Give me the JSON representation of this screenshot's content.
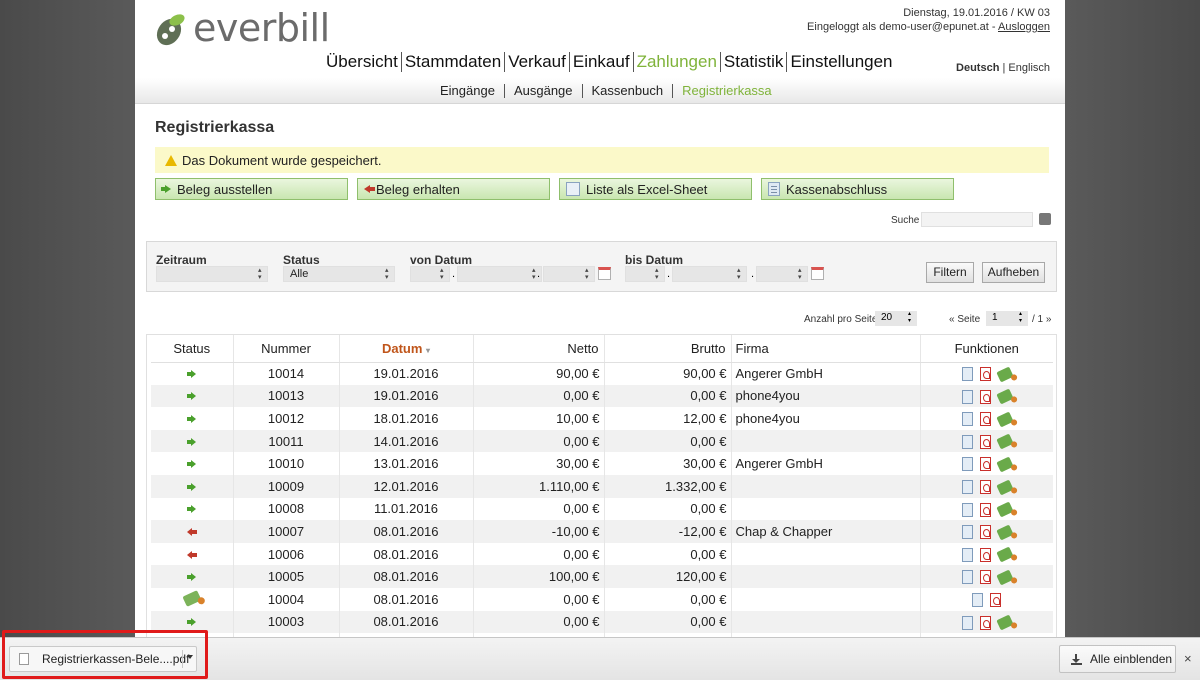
{
  "header": {
    "logo_text": "everbill",
    "date_line": "Dienstag, 19.01.2016 / KW 03",
    "login_line": "Eingeloggt als demo-user@epunet.at -",
    "logout_label": "Ausloggen"
  },
  "mainnav": [
    {
      "label": "Übersicht",
      "active": false
    },
    {
      "label": "Stammdaten",
      "active": false
    },
    {
      "label": "Verkauf",
      "active": false
    },
    {
      "label": "Einkauf",
      "active": false
    },
    {
      "label": "Zahlungen",
      "active": true
    },
    {
      "label": "Statistik",
      "active": false
    },
    {
      "label": "Einstellungen",
      "active": false
    }
  ],
  "language": {
    "current": "Deutsch",
    "separator": "|",
    "other": "Englisch"
  },
  "subnav": [
    {
      "label": "Eingänge",
      "active": false
    },
    {
      "label": "Ausgänge",
      "active": false
    },
    {
      "label": "Kassenbuch",
      "active": false
    },
    {
      "label": "Registrierkassa",
      "active": true
    }
  ],
  "page_title": "Registrierkassa",
  "notice": "Das Dokument wurde gespeichert.",
  "actions": {
    "issue": "Beleg ausstellen",
    "receive": "Beleg erhalten",
    "excel": "Liste als Excel-Sheet",
    "close": "Kassenabschluss"
  },
  "search": {
    "label": "Suche",
    "value": ""
  },
  "filters": {
    "period_label": "Zeitraum",
    "period_value": "",
    "status_label": "Status",
    "status_value": "Alle",
    "from_label": "von Datum",
    "to_label": "bis Datum",
    "dot": ".",
    "filter_button": "Filtern",
    "reset_button": "Aufheben"
  },
  "pager": {
    "per_page_label": "Anzahl pro Seite",
    "per_page_value": "20",
    "page_prefix": "« Seite",
    "page_value": "1",
    "page_total": "/ 1 »"
  },
  "table": {
    "columns": [
      "Status",
      "Nummer",
      "Datum",
      "Netto",
      "Brutto",
      "Firma",
      "Funktionen"
    ],
    "rows": [
      {
        "status": "green",
        "nummer": "10014",
        "datum": "19.01.2016",
        "netto": "90,00 €",
        "brutto": "90,00 €",
        "firma": "Angerer GmbH",
        "pay": true
      },
      {
        "status": "green",
        "nummer": "10013",
        "datum": "19.01.2016",
        "netto": "0,00 €",
        "brutto": "0,00 €",
        "firma": "phone4you",
        "pay": true
      },
      {
        "status": "green",
        "nummer": "10012",
        "datum": "18.01.2016",
        "netto": "10,00 €",
        "brutto": "12,00 €",
        "firma": "phone4you",
        "pay": true
      },
      {
        "status": "green",
        "nummer": "10011",
        "datum": "14.01.2016",
        "netto": "0,00 €",
        "brutto": "0,00 €",
        "firma": "",
        "pay": true
      },
      {
        "status": "green",
        "nummer": "10010",
        "datum": "13.01.2016",
        "netto": "30,00 €",
        "brutto": "30,00 €",
        "firma": "Angerer GmbH",
        "pay": true
      },
      {
        "status": "green",
        "nummer": "10009",
        "datum": "12.01.2016",
        "netto": "1.110,00 €",
        "brutto": "1.332,00 €",
        "firma": "",
        "pay": true
      },
      {
        "status": "green",
        "nummer": "10008",
        "datum": "11.01.2016",
        "netto": "0,00 €",
        "brutto": "0,00 €",
        "firma": "",
        "pay": true
      },
      {
        "status": "red",
        "nummer": "10007",
        "datum": "08.01.2016",
        "netto": "-10,00 €",
        "brutto": "-12,00 €",
        "firma": "Chap & Chapper",
        "pay": true
      },
      {
        "status": "red",
        "nummer": "10006",
        "datum": "08.01.2016",
        "netto": "0,00 €",
        "brutto": "0,00 €",
        "firma": "",
        "pay": true
      },
      {
        "status": "green",
        "nummer": "10005",
        "datum": "08.01.2016",
        "netto": "100,00 €",
        "brutto": "120,00 €",
        "firma": "",
        "pay": true
      },
      {
        "status": "money",
        "nummer": "10004",
        "datum": "08.01.2016",
        "netto": "0,00 €",
        "brutto": "0,00 €",
        "firma": "",
        "pay": false
      },
      {
        "status": "green",
        "nummer": "10003",
        "datum": "08.01.2016",
        "netto": "0,00 €",
        "brutto": "0,00 €",
        "firma": "",
        "pay": true
      },
      {
        "status": "green",
        "nummer": "",
        "datum": "",
        "netto": "",
        "brutto": "",
        "firma": "",
        "pay": true
      }
    ]
  },
  "downloads": {
    "file_name": "Registrierkassen-Bele....pdf",
    "show_all": "Alle einblenden",
    "close": "×"
  },
  "colors": {
    "accent_green": "#7fb33a",
    "sort_orange": "#c0551a",
    "highlight_red": "#e01a1a"
  }
}
